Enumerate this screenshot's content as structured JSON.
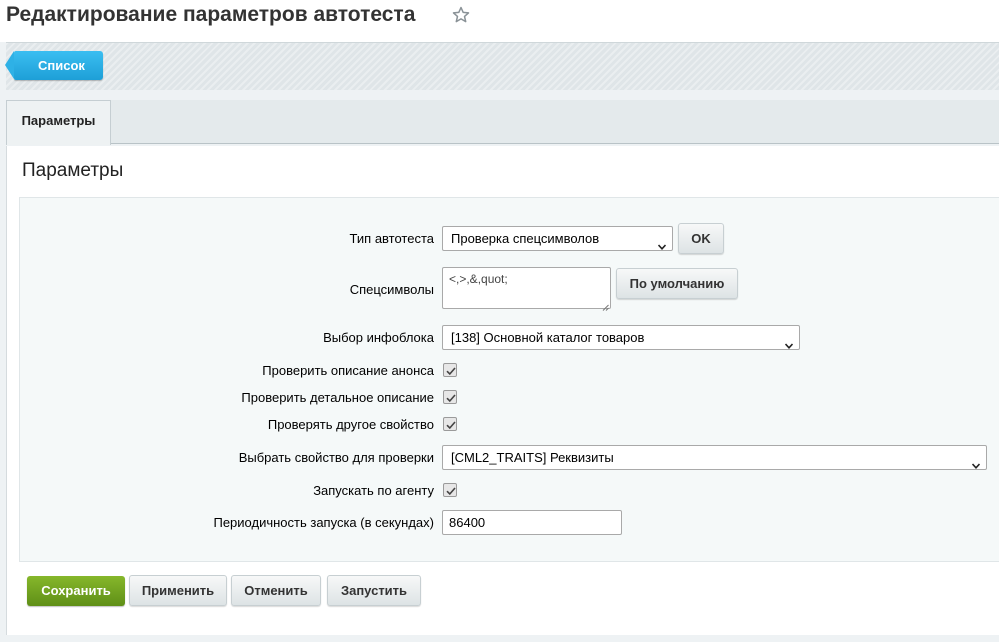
{
  "header": {
    "title": "Редактирование параметров автотеста",
    "favorite_icon": "star-outline-icon"
  },
  "toolbar": {
    "list_label": "Список"
  },
  "tabs": [
    {
      "label": "Параметры",
      "active": true
    }
  ],
  "section": {
    "title": "Параметры"
  },
  "form": {
    "test_type": {
      "label": "Тип автотеста",
      "value": "Проверка спецсимволов",
      "ok_label": "OK"
    },
    "special_chars": {
      "label": "Спецсимволы",
      "value": "<,>,&,quot;",
      "default_label": "По умолчанию"
    },
    "iblock": {
      "label": "Выбор инфоблока",
      "value": "[138] Основной каталог товаров"
    },
    "check_preview": {
      "label": "Проверить описание анонса",
      "checked": true
    },
    "check_detail": {
      "label": "Проверить детальное описание",
      "checked": true
    },
    "check_other_property": {
      "label": "Проверять другое свойство",
      "checked": true
    },
    "property": {
      "label": "Выбрать свойство для проверки",
      "value": "[CML2_TRAITS] Реквизиты"
    },
    "run_by_agent": {
      "label": "Запускать по агенту",
      "checked": true
    },
    "period": {
      "label": "Периодичность запуска (в секундах)",
      "value": "86400"
    }
  },
  "actions": {
    "save": "Сохранить",
    "apply": "Применить",
    "cancel": "Отменить",
    "run": "Запустить"
  },
  "colors": {
    "accent_blue": "#1e9fd7",
    "save_green": "#6fa11f"
  }
}
